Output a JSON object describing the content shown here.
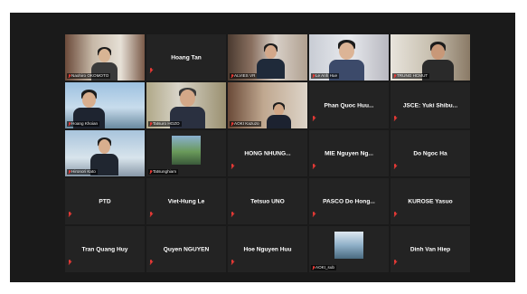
{
  "meeting": {
    "accent_color": "#d8d23c",
    "muted_icon_color": "#e53935",
    "tile_background": "#232323"
  },
  "participants": [
    {
      "name": "Naohiro OKOMOTO",
      "video": true
    },
    {
      "name": "Hoang Tan",
      "video": false
    },
    {
      "name": "ALVIES VR",
      "video": true
    },
    {
      "name": "Le Anh Hue",
      "video": true
    },
    {
      "name": "TRUNG HCMUT",
      "video": true
    },
    {
      "name": "Hoang Khoian",
      "video": true
    },
    {
      "name": "Tatsuro HOZO",
      "video": true,
      "active_speaker": true
    },
    {
      "name": "AOKI Kazuzo",
      "video": true
    },
    {
      "name": "Phan Quoc Huu...",
      "video": false
    },
    {
      "name": "JSCE: Yuki Shibu...",
      "video": false
    },
    {
      "name": "Hironori Kato",
      "video": true
    },
    {
      "name": "Tatsunghiam",
      "video": true
    },
    {
      "name": "HỒNG NHUNG...",
      "video": false
    },
    {
      "name": "MIE Nguyen Ng...",
      "video": false
    },
    {
      "name": "Do Ngoc Ha",
      "video": false
    },
    {
      "name": "PTD",
      "video": false
    },
    {
      "name": "Viet-Hung Le",
      "video": false
    },
    {
      "name": "Tetsuo UNO",
      "video": false
    },
    {
      "name": "PASCO Do Hong...",
      "video": false
    },
    {
      "name": "KUROSE Yasuo",
      "video": false
    },
    {
      "name": "Tran Quang Huy",
      "video": false
    },
    {
      "name": "Quyen NGUYEN",
      "video": false
    },
    {
      "name": "Hoe Nguyen Huu",
      "video": false
    },
    {
      "name": "AOKI_sub",
      "video": true
    },
    {
      "name": "Dinh Van Hiep",
      "video": false
    }
  ]
}
